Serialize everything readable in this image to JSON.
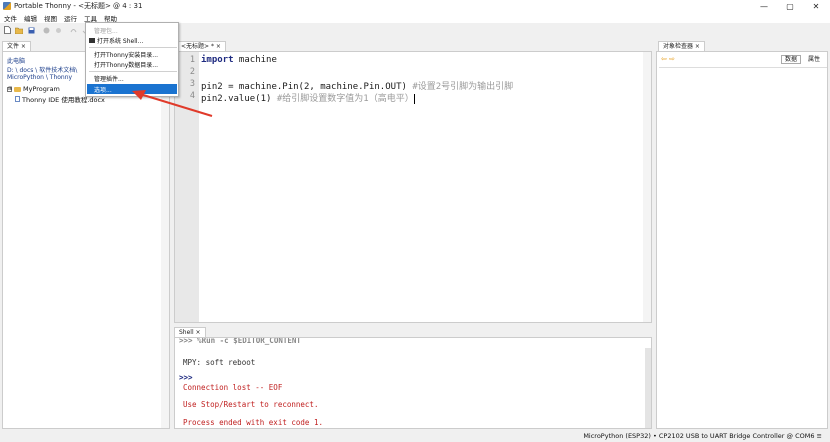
{
  "window": {
    "title": "Portable Thonny  -  <无标题>  @  4 : 31",
    "minimize": "—",
    "maximize": "▢",
    "close": "✕"
  },
  "menu": [
    "文件",
    "编辑",
    "视图",
    "运行",
    "工具",
    "帮助"
  ],
  "toolbar_icons": [
    "new-file-icon",
    "open-file-icon",
    "save-icon",
    "run-icon",
    "debug-icon",
    "step-over-icon",
    "step-into-icon"
  ],
  "files": {
    "tab": "文件 ×",
    "location_lines": [
      "此电脑",
      "D: \\ docs \\ 软件技术文档\\",
      "MicroPython \\ Thonny"
    ],
    "tree": [
      {
        "label": "MyProgram",
        "type": "folder",
        "expander": "⊞"
      },
      {
        "label": "Thonny IDE 使用教程.docx",
        "type": "file"
      }
    ]
  },
  "editor": {
    "tab": "<无标题> * ×",
    "lines": [
      {
        "no": "1",
        "kw": "import",
        "code": " machine",
        "comment": ""
      },
      {
        "no": "2",
        "kw": "",
        "code": "",
        "comment": ""
      },
      {
        "no": "3",
        "kw": "",
        "code": "pin2 = machine.Pin(2, machine.Pin.OUT) ",
        "comment": "#设置2号引脚为输出引脚"
      },
      {
        "no": "4",
        "kw": "",
        "code": "pin2.value(1) ",
        "comment": "#给引脚设置数字值为1（高电平）"
      }
    ]
  },
  "shell": {
    "tab": "Shell ×",
    "lines": [
      {
        "cls": "prompt",
        "text": ">>> %Run -c $EDITOR_CONTENT"
      },
      {
        "cls": "out",
        "text": "MPY: soft reboot"
      },
      {
        "cls": "prompt",
        "text": ">>>"
      },
      {
        "cls": "err",
        "text": "Connection lost -- EOF"
      },
      {
        "cls": "err",
        "text": "Use Stop/Restart to reconnect."
      },
      {
        "cls": "err",
        "text": "Process ended with exit code 1."
      }
    ]
  },
  "inspector": {
    "tab": "对象检查器 ×",
    "nav": "⇦ ⇨",
    "data_button": "数据",
    "attrs_button": "属性"
  },
  "status": {
    "text": "MicroPython (ESP32)  •  CP2102 USB to UART Bridge Controller @ COM6  ≡"
  },
  "tools_menu": {
    "items": [
      {
        "label": "管理包...",
        "disabled": true
      },
      {
        "label": "打开系统 Shell...",
        "disabled": false
      },
      {
        "label": "打开Thonny安装目录...",
        "disabled": false
      },
      {
        "label": "打开Thonny数据目录...",
        "disabled": false
      },
      {
        "label": "管理插件...",
        "disabled": false
      },
      {
        "label": "选项...",
        "disabled": false,
        "highlighted": true
      }
    ]
  },
  "colors": {
    "highlight": "#1a73d0",
    "annotation_arrow": "#e03a2a",
    "keyword": "#1e2a80",
    "error_text": "#c02020"
  }
}
